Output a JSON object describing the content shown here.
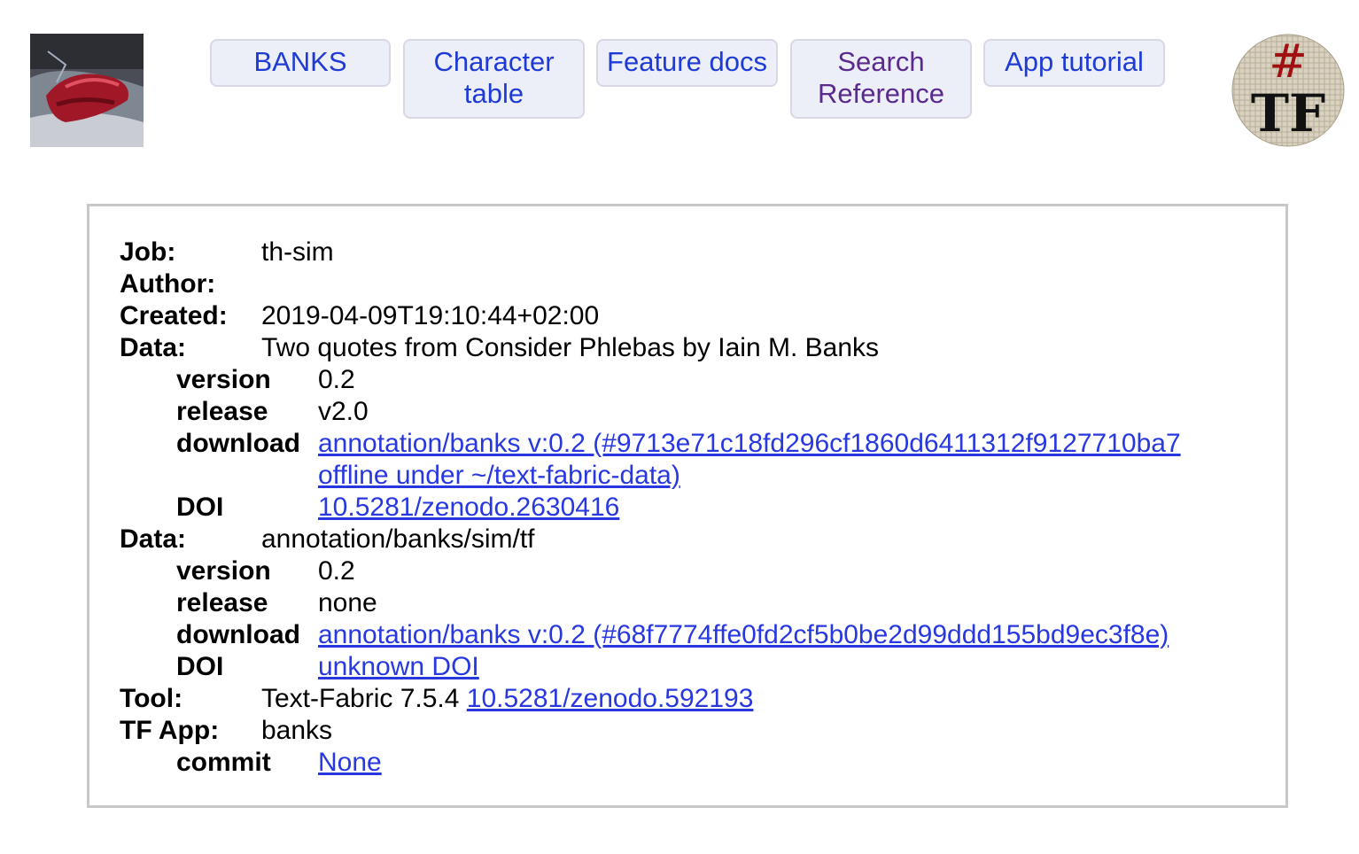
{
  "nav": {
    "banks": "BANKS",
    "character_table_1": "Character",
    "character_table_2": "table",
    "feature_docs": "Feature docs",
    "search_ref_1": "Search",
    "search_ref_2": "Reference",
    "app_tutorial": "App tutorial"
  },
  "logo_right": {
    "hash": "#",
    "letters": "TF"
  },
  "info": {
    "job_label": "Job:",
    "job_value": "th-sim",
    "author_label": "Author:",
    "created_label": "Created:",
    "created_value": "2019-04-09T19:10:44+02:00",
    "data1": {
      "label": "Data:",
      "value": "Two quotes from Consider Phlebas by Iain M. Banks",
      "version_label": "version",
      "version_value": "0.2",
      "release_label": "release",
      "release_value": "v2.0",
      "download_label": "download",
      "download_line1": "annotation/banks v:0.2 (#9713e71c18fd296cf1860d6411312f9127710ba7",
      "download_line2": "offline under ~/text-fabric-data)",
      "doi_label": "DOI",
      "doi_value": "10.5281/zenodo.2630416"
    },
    "data2": {
      "label": "Data:",
      "value": "annotation/banks/sim/tf",
      "version_label": "version",
      "version_value": "0.2",
      "release_label": "release",
      "release_value": "none",
      "download_label": "download",
      "download_value": "annotation/banks v:0.2 (#68f7774ffe0fd2cf5b0be2d99ddd155bd9ec3f8e)",
      "doi_label": "DOI",
      "doi_value": "unknown DOI"
    },
    "tool_label": "Tool:",
    "tool_value": "Text-Fabric 7.5.4",
    "tool_doi": "10.5281/zenodo.592193",
    "app_label": "TF App:",
    "app_value": "banks",
    "commit_label": "commit",
    "commit_value": "None"
  },
  "colors": {
    "link": "#2838e0",
    "nav_blue": "#1f3bd6",
    "nav_visited": "#5a2a8c",
    "button_bg": "#eceef8",
    "panel_border": "#c8c8c8"
  }
}
